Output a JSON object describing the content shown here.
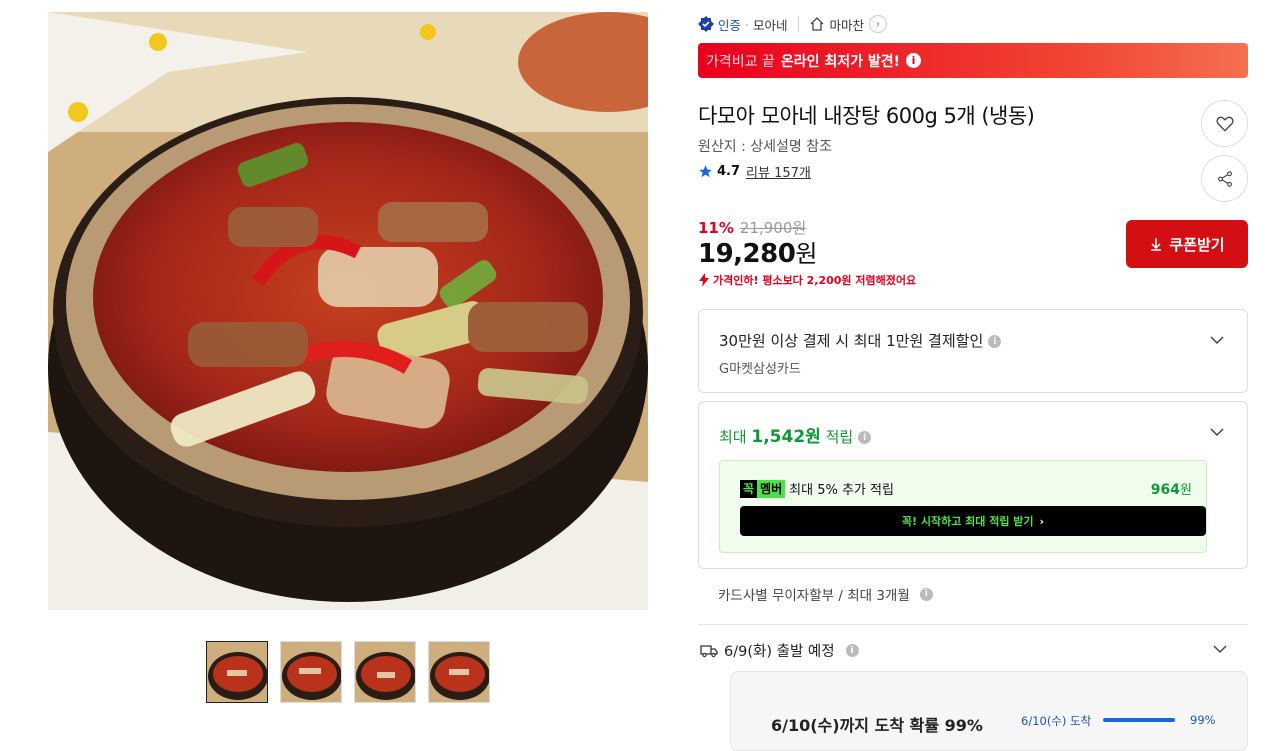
{
  "gallery": {
    "thumbnail_count": 4,
    "active_index": 0
  },
  "badges": {
    "verified": "인증",
    "seller": "모아네",
    "store_name": "마마찬"
  },
  "banner": {
    "lead": "가격비교 끝",
    "headline": "온라인 최저가 발견!"
  },
  "product": {
    "title": "다모아 모아네 내장탕 600g 5개 (냉동)",
    "origin": "원산지 : 상세설명 참조",
    "rating": "4.7",
    "reviews": "리뷰 157개"
  },
  "price": {
    "discount_pct": "11%",
    "original": "21,900원",
    "current": "19,280",
    "currency": "원",
    "drop_notice": "가격인하! 평소보다 2,200원 저렴해졌어요"
  },
  "coupon_label": "쿠폰받기",
  "card_discount": {
    "title": "30만원 이상 결제 시 최대 1만원 결제할인",
    "card": "G마켓삼성카드"
  },
  "points": {
    "prefix": "최대",
    "amount": "1,542원",
    "suffix": "적립",
    "member_badge_a": "꼭",
    "member_badge_b": "멤버",
    "member_text": "최대 5% 추가 적립",
    "member_points": "964",
    "member_points_unit": "원",
    "member_cta": "꼭! 시작하고 최대 적립 받기"
  },
  "installment": "카드사별 무이자할부 / 최대 3개월",
  "shipping": {
    "depart": "6/9(화) 출발 예정",
    "arrival_title": "6/10(수)까지 도착 확률 99%",
    "arrival_date": "6/10(수) 도착",
    "arrival_probability": 0.99,
    "arrival_pct": "99%"
  },
  "colors": {
    "accent_red": "#e8001e",
    "points_green": "#0c9a36",
    "member_green": "#4ee14a",
    "link_blue": "#1856b8"
  }
}
